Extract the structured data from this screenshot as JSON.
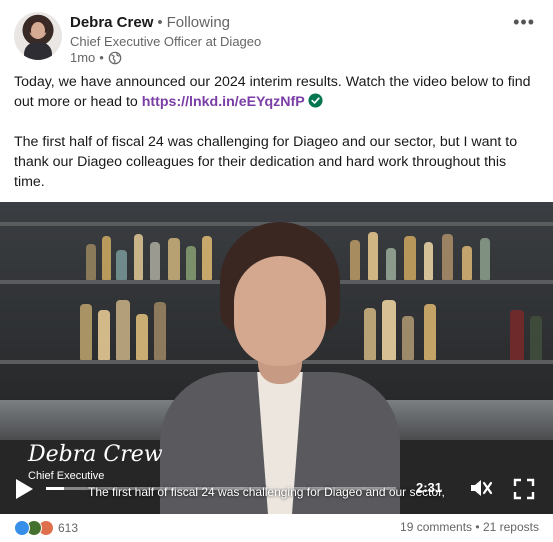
{
  "author": {
    "name": "Debra Crew",
    "relation": "Following",
    "separator": "•",
    "title": "Chief Executive Officer at Diageo",
    "time": "1mo",
    "time_separator": "•",
    "visibility_icon": "globe-icon"
  },
  "menu": {
    "more_label": "•••"
  },
  "post": {
    "paragraph1_text": "Today, we have announced our 2024 interim results. Watch the video below to find out more or head to ",
    "link": "https://lnkd.in/eEYqzNfP",
    "verified_icon": "check-circle-icon",
    "paragraph2": "The first half of fiscal 24 was challenging for Diageo and our sector, but I want to thank our Diageo colleagues for their dedication and hard work throughout this time."
  },
  "video": {
    "caption_name": "Debra Crew",
    "caption_role": "Chief Executive",
    "subtitle": "The first half of fiscal 24 was challenging for Diageo and our sector,",
    "time_remaining": "2:31",
    "progress_fraction": 0.05,
    "play_icon": "play-icon",
    "mute_icon": "mute-icon",
    "fullscreen_icon": "fullscreen-icon"
  },
  "social": {
    "reaction_count": "613",
    "comments": "19 comments",
    "reposts": "21 reposts",
    "separator": "•",
    "reaction_colors": [
      "#378fe9",
      "#44712e",
      "#df704d"
    ]
  },
  "colors": {
    "link": "#7a3ea6",
    "verified": "#01754f",
    "muted": "#666666"
  }
}
